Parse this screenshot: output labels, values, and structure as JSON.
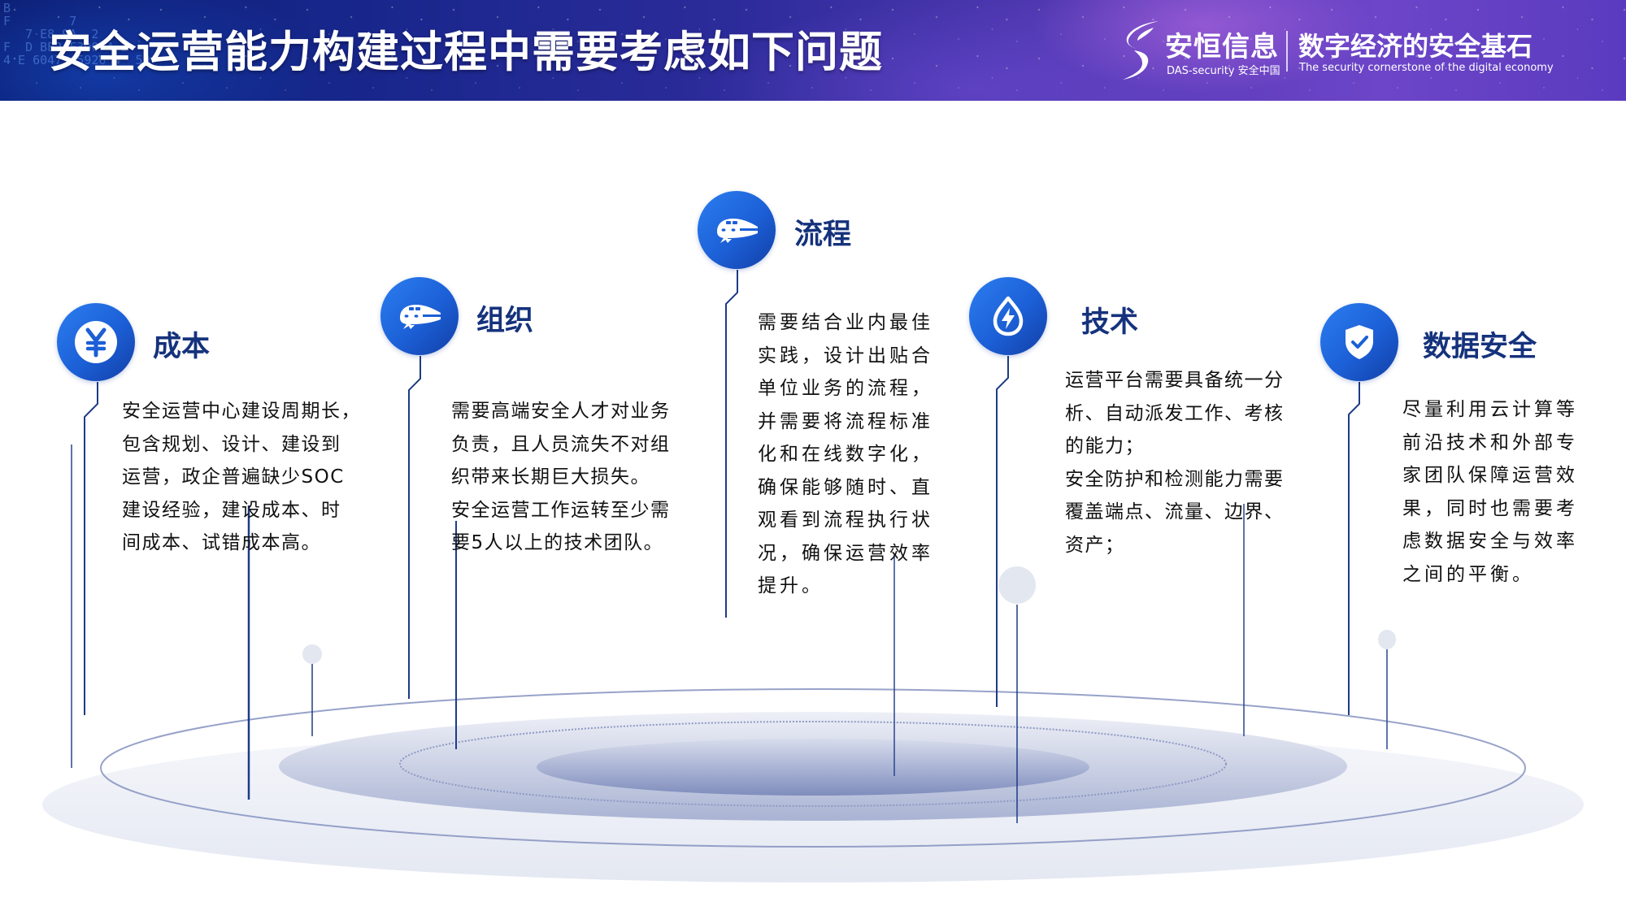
{
  "header": {
    "title": "安全运营能力构建过程中需要考虑如下问题",
    "background_code": "B\nF        7\n   7 E8 9A  2\nF  D BE2 F3D0 4 2\n4 E 6047  5926 4  59"
  },
  "brand": {
    "logo_icon": "das-security-logo-icon",
    "name": "安恒信息",
    "subtitle": "DAS-security 安全中国",
    "slogan": "数字经济的安全基石",
    "slogan_en": "The security cornerstone of the digital economy"
  },
  "colors": {
    "icon_blue": "#1c5fd6",
    "title_navy": "#15327c",
    "line_navy": "#1d3b86",
    "text": "#111111",
    "platform": "#b5bfdc"
  },
  "items": [
    {
      "title": "成本",
      "icon": "yen-icon",
      "lines": [
        "安全运营中心建设周期长，",
        "包含规划、设计、建设到",
        "运营，政企普遍缺少SOC",
        "建设经验，建设成本、时",
        "间成本、试错成本高。"
      ]
    },
    {
      "title": "组织",
      "icon": "train-icon",
      "lines": [
        "需要高端安全人才对业务",
        "负责，且人员流失不对组",
        "织带来长期巨大损失。",
        "安全运营工作运转至少需",
        "要5人以上的技术团队。"
      ]
    },
    {
      "title": "流程",
      "icon": "train-icon",
      "lines": [
        "需要结合业内最佳",
        "实践，设计出贴合",
        "单位业务的流程，",
        "并需要将流程标准",
        "化和在线数字化，",
        "确保能够随时、直",
        "观看到流程执行状",
        "况，确保运营效率",
        "提升。"
      ]
    },
    {
      "title": "技术",
      "icon": "energy-drop-icon",
      "lines": [
        "运营平台需要具备统一分",
        "析、自动派发工作、考核",
        "的能力；",
        "安全防护和检测能力需要",
        "覆盖端点、流量、边界、",
        "资产；"
      ]
    },
    {
      "title": "数据安全",
      "icon": "shield-check-icon",
      "lines": [
        "尽量利用云计算等",
        "前沿技术和外部专",
        "家团队保障运营效",
        "果，同时也需要考",
        "虑数据安全与效率",
        "之间的平衡。"
      ]
    }
  ]
}
